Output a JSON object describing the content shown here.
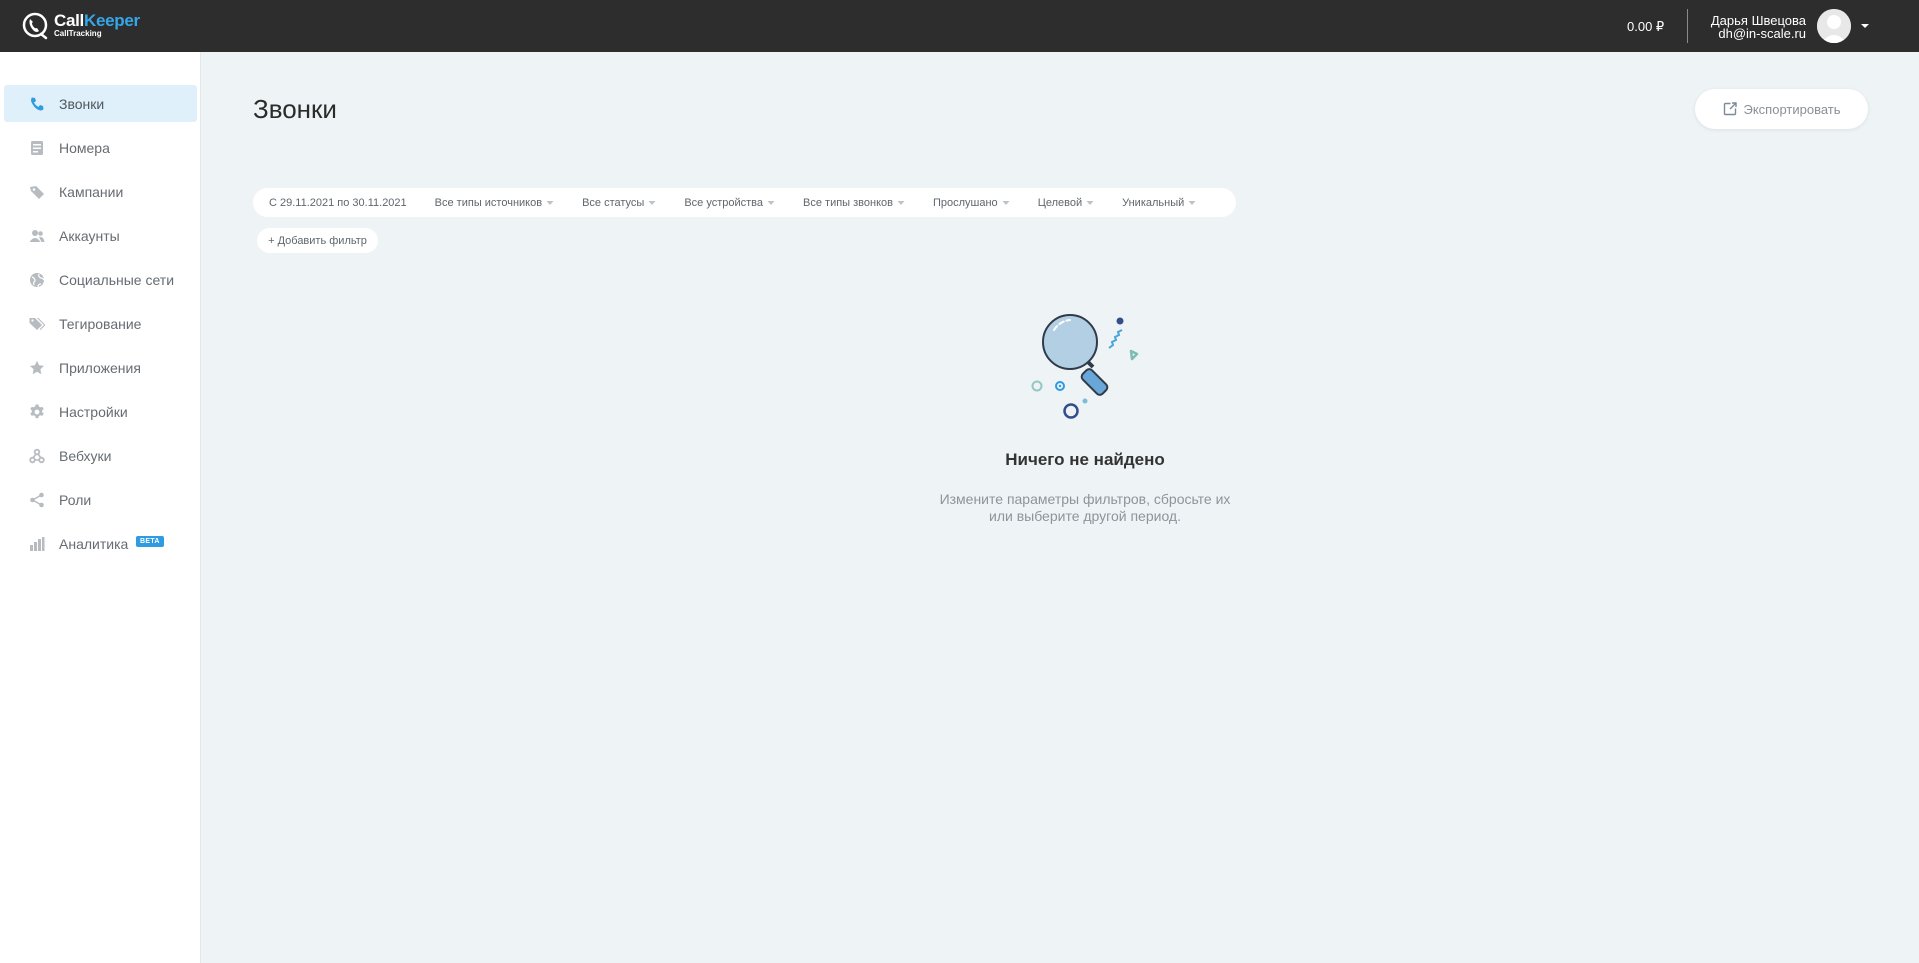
{
  "app": {
    "logo_name_part1": "Call",
    "logo_name_part2": "Keeper",
    "logo_subtitle": "CallTracking",
    "brand_color": "#35a7e8"
  },
  "header": {
    "balance": "0.00 ₽",
    "user_name": "Дарья Швецова",
    "user_email": "dh@in-scale.ru"
  },
  "sidebar": {
    "items": [
      {
        "label": "Звонки",
        "icon": "phone-icon",
        "active": true
      },
      {
        "label": "Номера",
        "icon": "numbers-icon"
      },
      {
        "label": "Кампании",
        "icon": "campaigns-icon"
      },
      {
        "label": "Аккаунты",
        "icon": "users-icon"
      },
      {
        "label": "Социальные сети",
        "icon": "globe-icon"
      },
      {
        "label": "Тегирование",
        "icon": "tags-icon"
      },
      {
        "label": "Приложения",
        "icon": "apps-icon"
      },
      {
        "label": "Настройки",
        "icon": "gear-icon"
      },
      {
        "label": "Вебхуки",
        "icon": "webhook-icon"
      },
      {
        "label": "Роли",
        "icon": "share-icon"
      },
      {
        "label": "Аналитика",
        "icon": "bar-chart-icon",
        "badge": "BETA"
      }
    ]
  },
  "main": {
    "title": "Звонки",
    "export_label": "Экспортировать",
    "filters": {
      "date": "С 29.11.2021 по 30.11.2021",
      "sources": "Все типы источников",
      "statuses": "Все статусы",
      "devices": "Все устройства",
      "call_types": "Все типы звонков",
      "listened": "Прослушано",
      "target": "Целевой",
      "unique": "Уникальный"
    },
    "add_filter": "+ Добавить фильтр",
    "empty": {
      "title": "Ничего не найдено",
      "text_line1": "Измените параметры фильтров, сбросьте их",
      "text_line2": "или выберите другой период."
    }
  }
}
